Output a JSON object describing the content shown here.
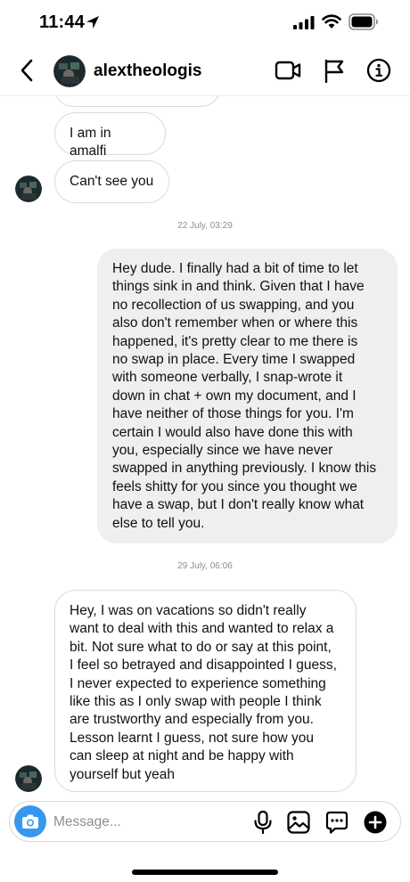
{
  "status_bar": {
    "time": "11:44"
  },
  "header": {
    "contact_name": "alextheologis",
    "back_icon": "back-chevron-icon",
    "actions": [
      "video-call-icon",
      "report-flag-icon",
      "info-icon"
    ]
  },
  "thread": {
    "messages": [
      {
        "direction": "incoming",
        "text": "I am in amalfi"
      },
      {
        "direction": "incoming",
        "text": "Can't see you"
      },
      {
        "direction": "separator",
        "text": "22 July, 03:29"
      },
      {
        "direction": "outgoing",
        "text": "Hey dude. I finally had a bit of time to let\nthings sink in and think. Given that I have\nno recollection of us swapping, and you\nalso don't remember when or where this\nhappened, it's pretty clear to me there is\nno swap in place. Every time I swapped\nwith someone verbally, I snap-wrote it\ndown in chat + own my document, and I\nhave neither of those things for you. I'm\ncertain I would also have done this with\nyou, especially since we have never\nswapped in anything previously. I know this\nfeels shitty for you since you thought we\nhave a swap, but I don't really know what\nelse to tell you."
      },
      {
        "direction": "separator",
        "text": "29 July, 06:06"
      },
      {
        "direction": "incoming",
        "text": "Hey, I was on vacations so didn't really\nwant to deal with this and wanted to relax a\nbit. Not sure what to do or say at this point,\nI feel so betrayed and disappointed I guess,\nI never expected to experience something\nlike this as I only swap with people I think\nare trustworthy and especially from you.\nLesson learnt I guess, not sure how you\ncan sleep at night and be happy with\nyourself but yeah"
      }
    ]
  },
  "composer": {
    "placeholder": "Message...",
    "icons": [
      "camera-icon",
      "microphone-icon",
      "gallery-icon",
      "sticker-icon",
      "plus-icon"
    ]
  },
  "colors": {
    "accent": "#3797f0",
    "outgoing_bubble": "#efefef",
    "incoming_border": "#dbdbdb",
    "timestamp": "#8e8e8e"
  }
}
